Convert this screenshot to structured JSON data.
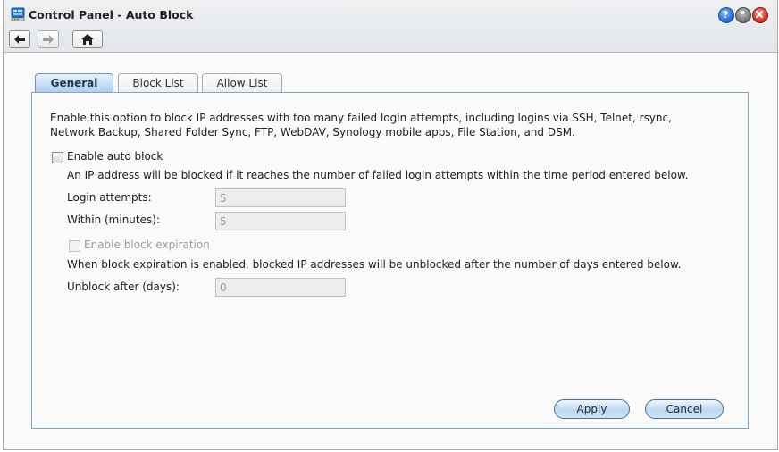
{
  "window": {
    "title": "Control Panel - Auto Block",
    "icons": {
      "app": "control-panel-icon",
      "help": "help-icon",
      "minimize": "minimize-icon",
      "close": "close-icon",
      "back": "arrow-left-icon",
      "forward": "arrow-right-icon",
      "home": "home-icon"
    },
    "colors": {
      "help": "#2d6fd1",
      "minimize": "#7a7a7a",
      "close": "#d9362e",
      "accent": "#7fa7c1"
    }
  },
  "tabs": [
    {
      "label": "General",
      "active": true
    },
    {
      "label": "Block List",
      "active": false
    },
    {
      "label": "Allow List",
      "active": false
    }
  ],
  "general": {
    "description_line1": "Enable this option to block IP addresses with too many failed login attempts, including logins via SSH, Telnet, rsync,",
    "description_line2": "Network Backup, Shared Folder Sync, FTP, WebDAV, Synology mobile apps, File Station, and DSM.",
    "enable_auto_block": {
      "label": "Enable auto block",
      "checked": false
    },
    "auto_block_hint": "An IP address will be blocked if it reaches the number of failed login attempts within the time period entered below.",
    "login_attempts": {
      "label": "Login attempts:",
      "value": "5"
    },
    "within_minutes": {
      "label": "Within (minutes):",
      "value": "5"
    },
    "enable_block_expiration": {
      "label": "Enable block expiration",
      "checked": false,
      "disabled": true
    },
    "expiration_hint": "When block expiration is enabled, blocked IP addresses will be unblocked after the number of days entered below.",
    "unblock_after_days": {
      "label": "Unblock after (days):",
      "value": "0"
    }
  },
  "footer": {
    "apply_label": "Apply",
    "cancel_label": "Cancel"
  }
}
